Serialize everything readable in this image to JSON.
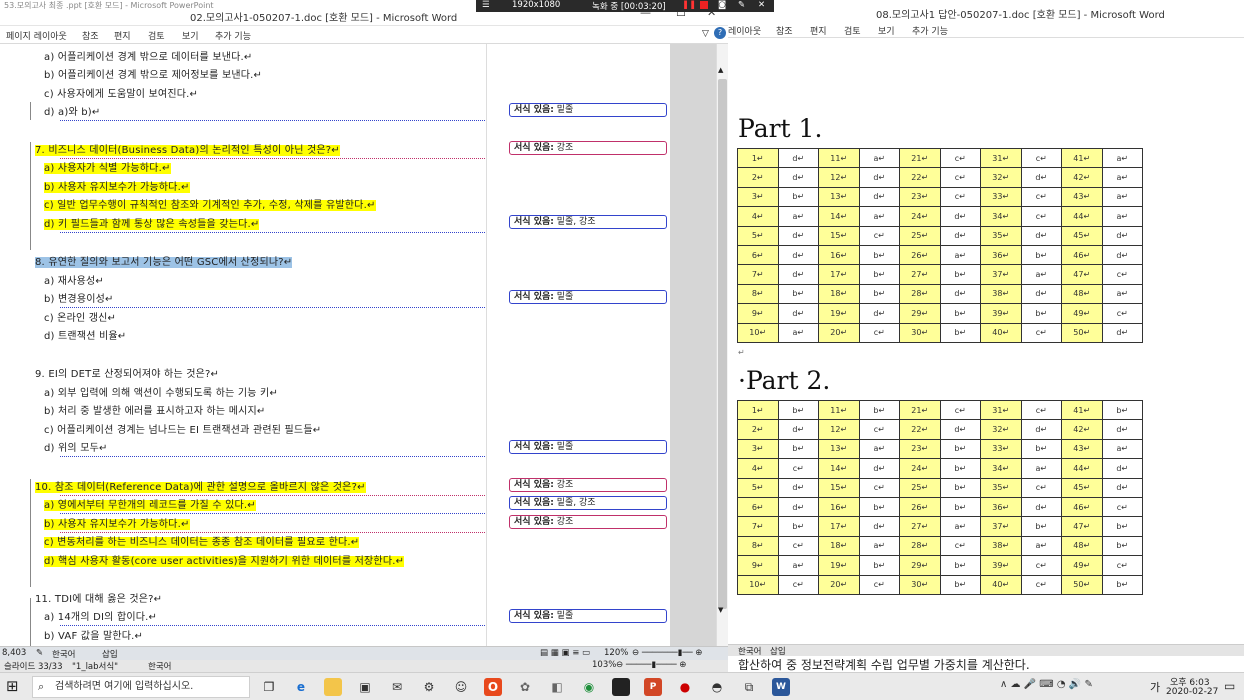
{
  "left": {
    "title": "02.모의고사1-050207-1.doc [호환 모드] - Microsoft Word",
    "title_behind": "53.모의고사 최종 .ppt [호환 모드] - Microsoft PowerPoint",
    "ribbon_tabs": [
      "페이지 레이아웃",
      "참조",
      "편지",
      "검토",
      "보기",
      "추가 기능"
    ],
    "lines": [
      {
        "text": "a) 어플리케이션 경계 밖으로 데이터를 보낸다.↵",
        "hl": ""
      },
      {
        "text": "b) 어플리케이션 경계 밖으로 제어정보를 보낸다.↵",
        "hl": ""
      },
      {
        "text": "c) 사용자에게 도움말이 보여진다.↵",
        "hl": ""
      },
      {
        "text": "d) a)와 b)↵",
        "hl": ""
      },
      {
        "text": "7. 비즈니스 데이터(Business Data)의 논리적인 특성이 아닌 것은?↵",
        "hl": "y"
      },
      {
        "text": "a) 사용자가 식별 가능하다.↵",
        "hl": "y"
      },
      {
        "text": "b) 사용자 유지보수가 가능하다.↵",
        "hl": "y"
      },
      {
        "text": "c) 일반 업무수행이 규칙적인 참조와 기계적인 추가, 수정, 삭제를 유발한다.↵",
        "hl": "y"
      },
      {
        "text": "d) 키 필드들과 함께 통상 많은 속성들을 갖는다.↵",
        "hl": "y"
      },
      {
        "text": "8. 유연한 질의와 보고서 기능은 어떤 GSC에서 산정되나?↵",
        "hl": "b"
      },
      {
        "text": "a) 재사용성↵",
        "hl": ""
      },
      {
        "text": "b) 변경용이성↵",
        "hl": ""
      },
      {
        "text": "c) 온라인 갱신↵",
        "hl": ""
      },
      {
        "text": "d) 트랜잭션 비율↵",
        "hl": ""
      },
      {
        "text": "9. EI의 DET로 산정되어져야 하는 것은?↵",
        "hl": ""
      },
      {
        "text": "a) 외부 입력에 의해 액션이 수행되도록 하는 기능 키↵",
        "hl": ""
      },
      {
        "text": "b) 처리 중 발생한 에러를 표시하고자 하는 메시지↵",
        "hl": ""
      },
      {
        "text": "c) 어플리케이션 경계는 넘나드는 EI 트랜잭션과 관련된 필드들↵",
        "hl": ""
      },
      {
        "text": "d) 위의 모두↵",
        "hl": ""
      },
      {
        "text": "10. 참조 데이터(Reference Data)에 관한 설명으로 올바르지 않은 것은?↵",
        "hl": "y"
      },
      {
        "text": "a) 영에서부터 무한개의 레코드를 가질 수 있다.↵",
        "hl": "y"
      },
      {
        "text": "b) 사용자 유지보수가 가능하다.↵",
        "hl": "y"
      },
      {
        "text": "c) 변동처리를 하는 비즈니스 데이터는 종종 참조 데이터를 필요로 한다.↵",
        "hl": "y"
      },
      {
        "text": "d) 핵심 사용자 활동(core user activities)을 지원하기 위한 데이터를 저장한다.↵",
        "hl": "y"
      },
      {
        "text": "11. TDI에 대해 옳은 것은?↵",
        "hl": ""
      },
      {
        "text": "a) 14개의 DI의 합이다.↵",
        "hl": ""
      },
      {
        "text": "b) VAF 값을 말한다.↵",
        "hl": ""
      }
    ],
    "comments": [
      {
        "label": "서식 있음:",
        "value": "밑줄"
      },
      {
        "label": "서식 있음:",
        "value": "강조"
      },
      {
        "label": "서식 있음:",
        "value": "밑줄, 강조"
      },
      {
        "label": "서식 있음:",
        "value": "밑줄"
      },
      {
        "label": "서식 있음:",
        "value": "밑줄"
      },
      {
        "label": "서식 있음:",
        "value": "강조"
      },
      {
        "label": "서식 있음:",
        "value": "밑줄, 강조"
      },
      {
        "label": "서식 있음:",
        "value": "강조"
      },
      {
        "label": "서식 있음:",
        "value": "밑줄"
      }
    ],
    "status": {
      "words": "8,403",
      "lang": "한국어",
      "mode": "삽입",
      "zoom": "120%"
    },
    "status2": {
      "slide": "슬라이드 33/33",
      "theme": "\"1_lab서식\"",
      "lang": "한국어",
      "zoom": "103%"
    }
  },
  "right": {
    "title": "08.모의고사1 답안-050207-1.doc [호환 모드] - Microsoft Word",
    "ribbon_tabs": [
      "레이아웃",
      "참조",
      "편지",
      "검토",
      "보기",
      "추가 기능"
    ],
    "part1_title": "Part 1.",
    "part2_title": "·Part 2.",
    "part1": [
      [
        "1↵",
        "d↵",
        "11↵",
        "a↵",
        "21↵",
        "c↵",
        "31↵",
        "c↵",
        "41↵",
        "a↵"
      ],
      [
        "2↵",
        "d↵",
        "12↵",
        "d↵",
        "22↵",
        "c↵",
        "32↵",
        "d↵",
        "42↵",
        "a↵"
      ],
      [
        "3↵",
        "b↵",
        "13↵",
        "d↵",
        "23↵",
        "c↵",
        "33↵",
        "c↵",
        "43↵",
        "a↵"
      ],
      [
        "4↵",
        "a↵",
        "14↵",
        "a↵",
        "24↵",
        "d↵",
        "34↵",
        "c↵",
        "44↵",
        "a↵"
      ],
      [
        "5↵",
        "d↵",
        "15↵",
        "c↵",
        "25↵",
        "d↵",
        "35↵",
        "d↵",
        "45↵",
        "d↵"
      ],
      [
        "6↵",
        "d↵",
        "16↵",
        "b↵",
        "26↵",
        "a↵",
        "36↵",
        "b↵",
        "46↵",
        "d↵"
      ],
      [
        "7↵",
        "d↵",
        "17↵",
        "b↵",
        "27↵",
        "b↵",
        "37↵",
        "a↵",
        "47↵",
        "c↵"
      ],
      [
        "8↵",
        "b↵",
        "18↵",
        "b↵",
        "28↵",
        "d↵",
        "38↵",
        "d↵",
        "48↵",
        "a↵"
      ],
      [
        "9↵",
        "d↵",
        "19↵",
        "d↵",
        "29↵",
        "b↵",
        "39↵",
        "b↵",
        "49↵",
        "c↵"
      ],
      [
        "10↵",
        "a↵",
        "20↵",
        "c↵",
        "30↵",
        "b↵",
        "40↵",
        "c↵",
        "50↵",
        "d↵"
      ]
    ],
    "part2": [
      [
        "1↵",
        "b↵",
        "11↵",
        "b↵",
        "21↵",
        "c↵",
        "31↵",
        "c↵",
        "41↵",
        "b↵"
      ],
      [
        "2↵",
        "d↵",
        "12↵",
        "c↵",
        "22↵",
        "d↵",
        "32↵",
        "d↵",
        "42↵",
        "d↵"
      ],
      [
        "3↵",
        "b↵",
        "13↵",
        "a↵",
        "23↵",
        "b↵",
        "33↵",
        "b↵",
        "43↵",
        "a↵"
      ],
      [
        "4↵",
        "c↵",
        "14↵",
        "d↵",
        "24↵",
        "b↵",
        "34↵",
        "a↵",
        "44↵",
        "d↵"
      ],
      [
        "5↵",
        "d↵",
        "15↵",
        "c↵",
        "25↵",
        "b↵",
        "35↵",
        "c↵",
        "45↵",
        "d↵"
      ],
      [
        "6↵",
        "d↵",
        "16↵",
        "b↵",
        "26↵",
        "b↵",
        "36↵",
        "d↵",
        "46↵",
        "c↵"
      ],
      [
        "7↵",
        "b↵",
        "17↵",
        "d↵",
        "27↵",
        "a↵",
        "37↵",
        "b↵",
        "47↵",
        "b↵"
      ],
      [
        "8↵",
        "c↵",
        "18↵",
        "a↵",
        "28↵",
        "c↵",
        "38↵",
        "a↵",
        "48↵",
        "b↵"
      ],
      [
        "9↵",
        "a↵",
        "19↵",
        "b↵",
        "29↵",
        "b↵",
        "39↵",
        "c↵",
        "49↵",
        "c↵"
      ],
      [
        "10↵",
        "c↵",
        "20↵",
        "c↵",
        "30↵",
        "b↵",
        "40↵",
        "c↵",
        "50↵",
        "b↵"
      ]
    ],
    "status": {
      "lang": "한국어",
      "mode": "삽입"
    },
    "behind_text": "합산하여 중 정보전략계획 수립 업무별 가중치를 계산한다."
  },
  "recorder": {
    "resolution": "1920x1080",
    "status": "녹화 중 [00:03:20]"
  },
  "taskbar": {
    "search_placeholder": "검색하려면 여기에 입력하십시오.",
    "ime": "가",
    "time": "오후 6:03",
    "date": "2020-02-27"
  },
  "colors": {
    "highlight_yellow": "#ffff00",
    "highlight_blue": "#9dc3e6",
    "answer_number_cell": "#ffff99",
    "comment_border": "#3344cc",
    "comment_border_red": "#c0306a"
  }
}
